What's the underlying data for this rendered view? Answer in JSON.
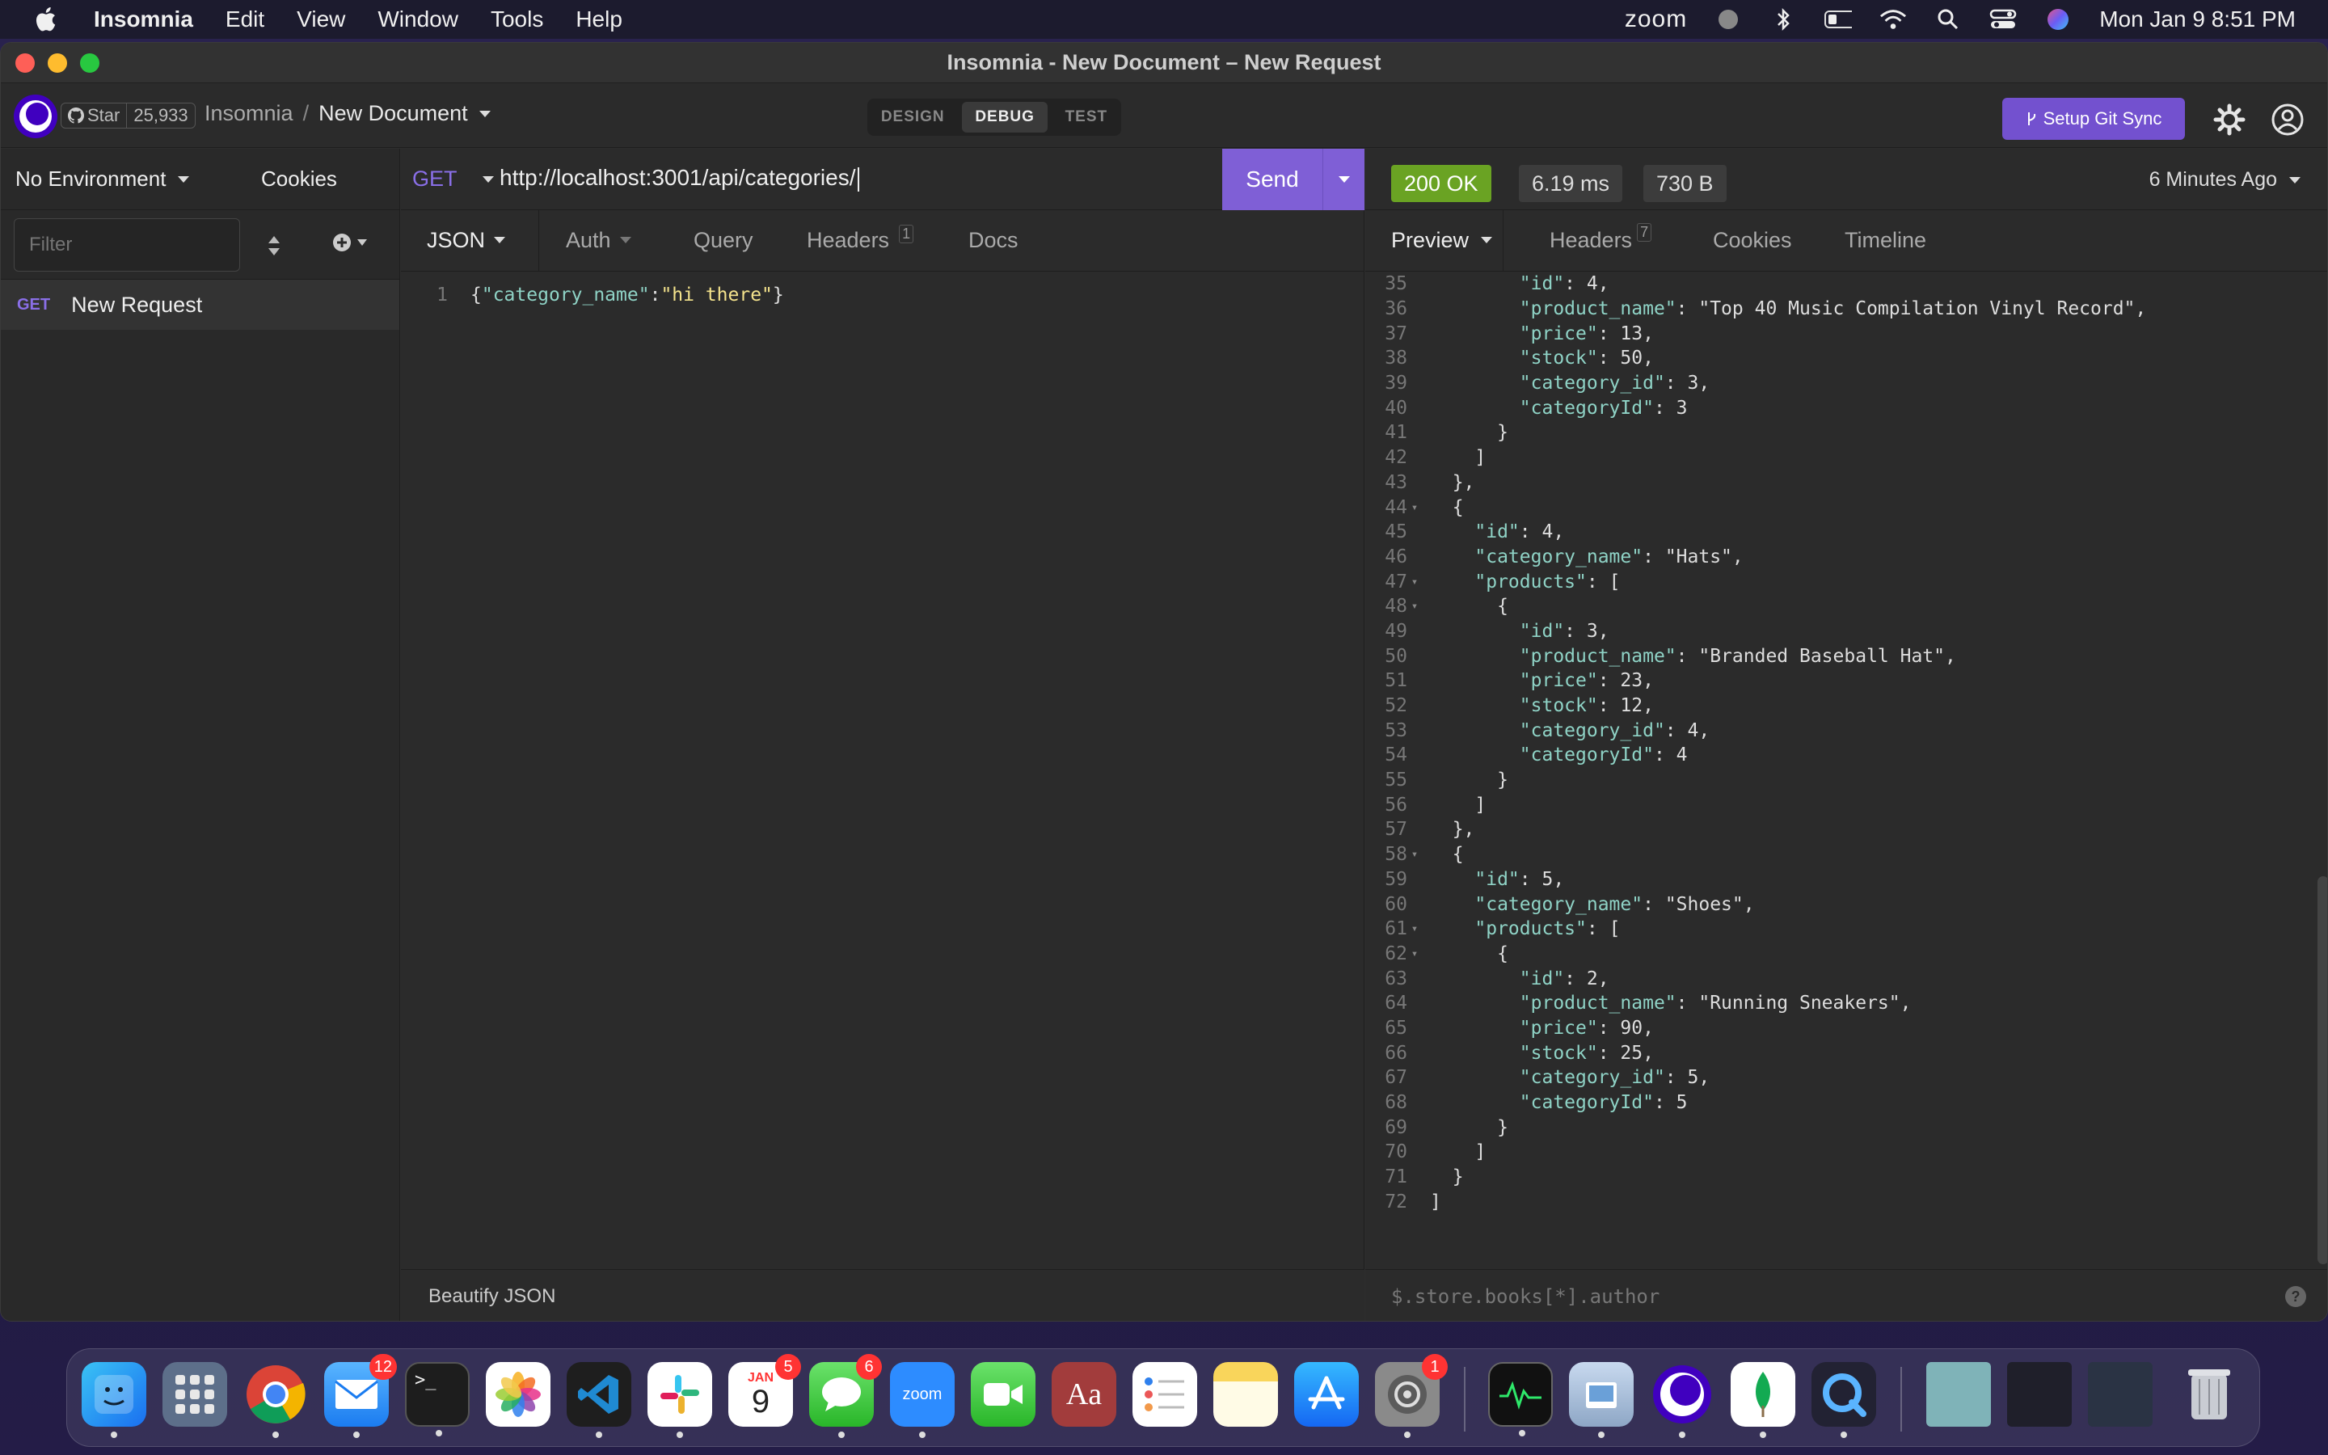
{
  "menubar": {
    "app_name": "Insomnia",
    "items": [
      "Edit",
      "View",
      "Window",
      "Tools",
      "Help"
    ],
    "zoom": "zoom",
    "clock": "Mon Jan 9  8:51 PM"
  },
  "window": {
    "title": "Insomnia - New Document – New Request"
  },
  "header": {
    "star_label": "Star",
    "star_count": "25,933",
    "breadcrumb_root": "Insomnia",
    "breadcrumb_sep": "/",
    "document": "New Document",
    "modes": [
      "DESIGN",
      "DEBUG",
      "TEST"
    ],
    "git_sync": "Setup Git Sync"
  },
  "sidebar": {
    "environment": "No Environment",
    "cookies": "Cookies",
    "filter_placeholder": "Filter",
    "request": {
      "method": "GET",
      "name": "New Request"
    }
  },
  "request": {
    "method": "GET",
    "url": "http://localhost:3001/api/categories/",
    "send": "Send",
    "tabs": {
      "body": "JSON",
      "auth": "Auth",
      "query": "Query",
      "headers": "Headers",
      "headers_count": "1",
      "docs": "Docs"
    },
    "body_line_no": "1",
    "body_key": "\"category_name\"",
    "body_val": "\"hi there\"",
    "footer": "Beautify JSON"
  },
  "response": {
    "status": "200 OK",
    "time": "6.19 ms",
    "size": "730 B",
    "ago": "6 Minutes Ago",
    "tabs": {
      "preview": "Preview",
      "headers": "Headers",
      "headers_count": "7",
      "cookies": "Cookies",
      "timeline": "Timeline"
    },
    "lines": [
      {
        "n": "35",
        "t": "        \"id\": 4,"
      },
      {
        "n": "36",
        "t": "        \"product_name\": \"Top 40 Music Compilation Vinyl Record\","
      },
      {
        "n": "37",
        "t": "        \"price\": 13,"
      },
      {
        "n": "38",
        "t": "        \"stock\": 50,"
      },
      {
        "n": "39",
        "t": "        \"category_id\": 3,"
      },
      {
        "n": "40",
        "t": "        \"categoryId\": 3"
      },
      {
        "n": "41",
        "t": "      }"
      },
      {
        "n": "42",
        "t": "    ]"
      },
      {
        "n": "43",
        "t": "  },"
      },
      {
        "n": "44",
        "t": "  {",
        "fold": true
      },
      {
        "n": "45",
        "t": "    \"id\": 4,"
      },
      {
        "n": "46",
        "t": "    \"category_name\": \"Hats\","
      },
      {
        "n": "47",
        "t": "    \"products\": [",
        "fold": true
      },
      {
        "n": "48",
        "t": "      {",
        "fold": true
      },
      {
        "n": "49",
        "t": "        \"id\": 3,"
      },
      {
        "n": "50",
        "t": "        \"product_name\": \"Branded Baseball Hat\","
      },
      {
        "n": "51",
        "t": "        \"price\": 23,"
      },
      {
        "n": "52",
        "t": "        \"stock\": 12,"
      },
      {
        "n": "53",
        "t": "        \"category_id\": 4,"
      },
      {
        "n": "54",
        "t": "        \"categoryId\": 4"
      },
      {
        "n": "55",
        "t": "      }"
      },
      {
        "n": "56",
        "t": "    ]"
      },
      {
        "n": "57",
        "t": "  },"
      },
      {
        "n": "58",
        "t": "  {",
        "fold": true
      },
      {
        "n": "59",
        "t": "    \"id\": 5,"
      },
      {
        "n": "60",
        "t": "    \"category_name\": \"Shoes\","
      },
      {
        "n": "61",
        "t": "    \"products\": [",
        "fold": true
      },
      {
        "n": "62",
        "t": "      {",
        "fold": true
      },
      {
        "n": "63",
        "t": "        \"id\": 2,"
      },
      {
        "n": "64",
        "t": "        \"product_name\": \"Running Sneakers\","
      },
      {
        "n": "65",
        "t": "        \"price\": 90,"
      },
      {
        "n": "66",
        "t": "        \"stock\": 25,"
      },
      {
        "n": "67",
        "t": "        \"category_id\": 5,"
      },
      {
        "n": "68",
        "t": "        \"categoryId\": 5"
      },
      {
        "n": "69",
        "t": "      }"
      },
      {
        "n": "70",
        "t": "    ]"
      },
      {
        "n": "71",
        "t": "  }"
      },
      {
        "n": "72",
        "t": "]"
      }
    ],
    "filter_placeholder": "$.store.books[*].author"
  },
  "dock": {
    "mail_badge": "12",
    "calendar_month": "JAN",
    "calendar_day": "9",
    "calendar_badge": "5",
    "messages_badge": "6",
    "zoom_label": "zoom",
    "dictionary_label": "Aa",
    "settings_badge": "1"
  },
  "colors": {
    "accent": "#7f5fd6",
    "status_ok": "#6aa323",
    "method": "#8a6fe8"
  }
}
